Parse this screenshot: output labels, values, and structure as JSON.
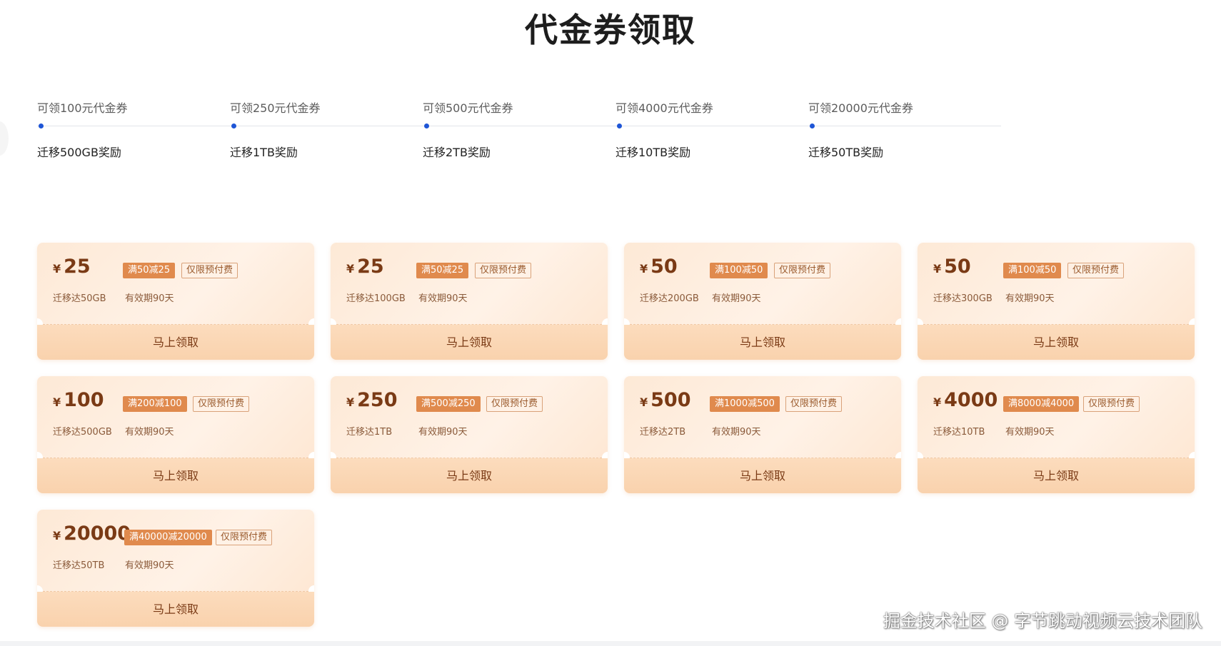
{
  "page": {
    "title": "代金券领取"
  },
  "steps": [
    {
      "label": "可领100元代金券",
      "desc": "迁移500GB奖励"
    },
    {
      "label": "可领250元代金券",
      "desc": "迁移1TB奖励"
    },
    {
      "label": "可领500元代金券",
      "desc": "迁移2TB奖励"
    },
    {
      "label": "可领4000元代金券",
      "desc": "迁移10TB奖励"
    },
    {
      "label": "可领20000元代金券",
      "desc": "迁移50TB奖励"
    }
  ],
  "coupons": [
    {
      "currency": "¥",
      "amount": "25",
      "rule": "满50减25",
      "scope": "仅限预付费",
      "condition": "迁移达50GB",
      "validity": "有效期90天",
      "action": "马上领取"
    },
    {
      "currency": "¥",
      "amount": "25",
      "rule": "满50减25",
      "scope": "仅限预付费",
      "condition": "迁移达100GB",
      "validity": "有效期90天",
      "action": "马上领取"
    },
    {
      "currency": "¥",
      "amount": "50",
      "rule": "满100减50",
      "scope": "仅限预付费",
      "condition": "迁移达200GB",
      "validity": "有效期90天",
      "action": "马上领取"
    },
    {
      "currency": "¥",
      "amount": "50",
      "rule": "满100减50",
      "scope": "仅限预付费",
      "condition": "迁移达300GB",
      "validity": "有效期90天",
      "action": "马上领取"
    },
    {
      "currency": "¥",
      "amount": "100",
      "rule": "满200减100",
      "scope": "仅限预付费",
      "condition": "迁移达500GB",
      "validity": "有效期90天",
      "action": "马上领取"
    },
    {
      "currency": "¥",
      "amount": "250",
      "rule": "满500减250",
      "scope": "仅限预付费",
      "condition": "迁移达1TB",
      "validity": "有效期90天",
      "action": "马上领取"
    },
    {
      "currency": "¥",
      "amount": "500",
      "rule": "满1000减500",
      "scope": "仅限预付费",
      "condition": "迁移达2TB",
      "validity": "有效期90天",
      "action": "马上领取"
    },
    {
      "currency": "¥",
      "amount": "4000",
      "rule": "满8000减4000",
      "scope": "仅限预付费",
      "condition": "迁移达10TB",
      "validity": "有效期90天",
      "action": "马上领取"
    },
    {
      "currency": "¥",
      "amount": "20000",
      "rule": "满40000减20000",
      "scope": "仅限预付费",
      "condition": "迁移达50TB",
      "validity": "有效期90天",
      "action": "马上领取"
    }
  ],
  "watermark": "掘金技术社区 @ 字节跳动视频云技术团队",
  "colors": {
    "accent": "#1e55d6",
    "tag": "#e08a4d",
    "text_brown": "#7a3a15"
  }
}
